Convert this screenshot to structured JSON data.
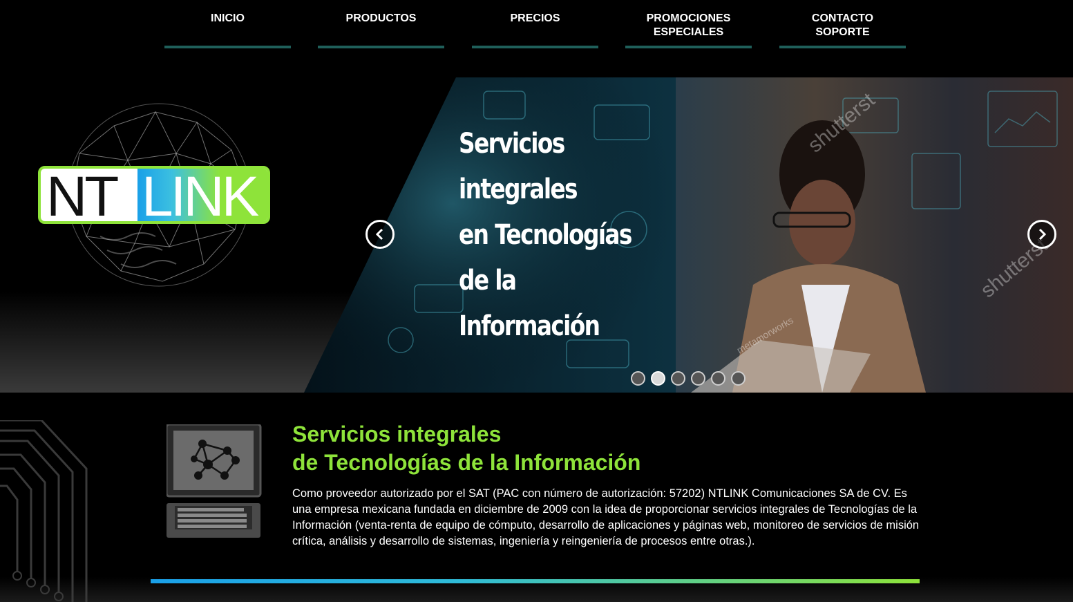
{
  "nav": {
    "items": [
      {
        "label": "INICIO"
      },
      {
        "label": "PRODUCTOS"
      },
      {
        "label": "PRECIOS"
      },
      {
        "label": "PROMOCIONES",
        "label2": "ESPECIALES"
      },
      {
        "label": "CONTACTO",
        "label2": "SOPORTE"
      }
    ]
  },
  "logo": {
    "part1": "NT",
    "part2": "LINK"
  },
  "hero": {
    "lines": [
      "Servicios",
      "integrales",
      "en Tecnologías",
      "de la",
      "Información"
    ],
    "watermarks": [
      "shutterst",
      "shutterst",
      "metamorworks"
    ],
    "slide_count": 6,
    "active_slide": 2
  },
  "about": {
    "title_line1": "Servicios integrales",
    "title_line2": "de Tecnologías de la Información",
    "body": "Como proveedor autorizado por el SAT (PAC con número de autorización: 57202) NTLINK Comunicaciones SA de CV. Es una empresa mexicana fundada en diciembre de 2009 con la idea de proporcionar servicios integrales de Tecnologías de la Información (venta-renta de equipo de cómputo, desarrollo de aplicaciones y páginas web, monitoreo de servicios de misión crítica, análisis y desarrollo de sistemas, ingeniería y reingeniería de procesos entre otras.)."
  },
  "colors": {
    "accent_green": "#8ee33a",
    "accent_blue": "#1aa0e8",
    "nav_underline": "#1f5f5a"
  }
}
